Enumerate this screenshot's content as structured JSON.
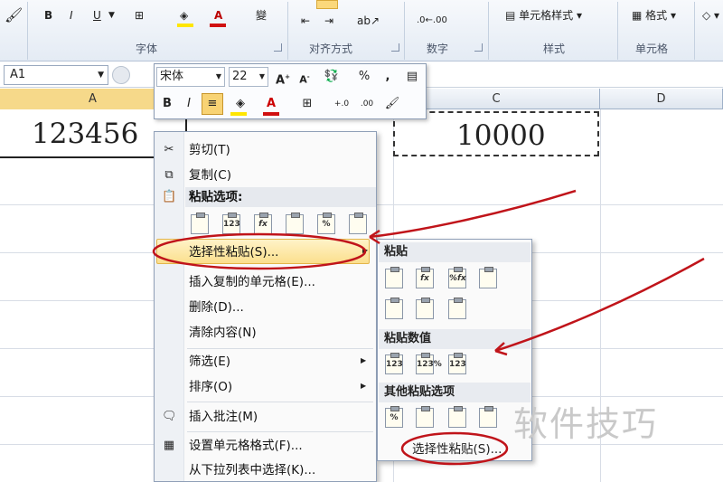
{
  "ribbon": {
    "groups": [
      "字体",
      "对齐方式",
      "数字",
      "样式",
      "单元格"
    ],
    "cell_style_label": "单元格样式",
    "format_label": "格式",
    "bold": "B",
    "italic": "I",
    "underline": "U"
  },
  "formula_bar": {
    "name_box": "A1"
  },
  "columns": [
    "A",
    "C",
    "D"
  ],
  "cells": {
    "a1": "123456",
    "c1": "10000"
  },
  "mini_toolbar": {
    "font": "宋体",
    "size": "22",
    "percent": "%",
    "comma": ","
  },
  "context_menu": {
    "items": [
      {
        "label": "剪切(T)",
        "icon": "scissors-icon"
      },
      {
        "label": "复制(C)",
        "icon": "copy-icon"
      },
      {
        "label": "粘贴选项:",
        "icon": "paste-icon"
      },
      {
        "label": "选择性粘贴(S)...",
        "icon": ""
      },
      {
        "label": "插入复制的单元格(E)...",
        "icon": ""
      },
      {
        "label": "删除(D)...",
        "icon": ""
      },
      {
        "label": "清除内容(N)",
        "icon": ""
      },
      {
        "label": "筛选(E)",
        "icon": ""
      },
      {
        "label": "排序(O)",
        "icon": ""
      },
      {
        "label": "插入批注(M)",
        "icon": "comment-icon"
      },
      {
        "label": "设置单元格格式(F)...",
        "icon": "format-cells-icon"
      },
      {
        "label": "从下拉列表中选择(K)...",
        "icon": ""
      }
    ],
    "paste_icons": [
      "123",
      "fx",
      "%"
    ]
  },
  "submenu": {
    "paste_title": "粘贴",
    "values_title": "粘贴数值",
    "other_title": "其他粘贴选项",
    "special": "选择性粘贴(S)...",
    "icon_labels": [
      "fx",
      "%fx",
      "123",
      "123%",
      "%"
    ]
  },
  "watermark": "软件技巧",
  "colors": {
    "highlight": "#fde9a0",
    "annotation": "#c0141a",
    "ribbon": "#e4ebf4"
  }
}
